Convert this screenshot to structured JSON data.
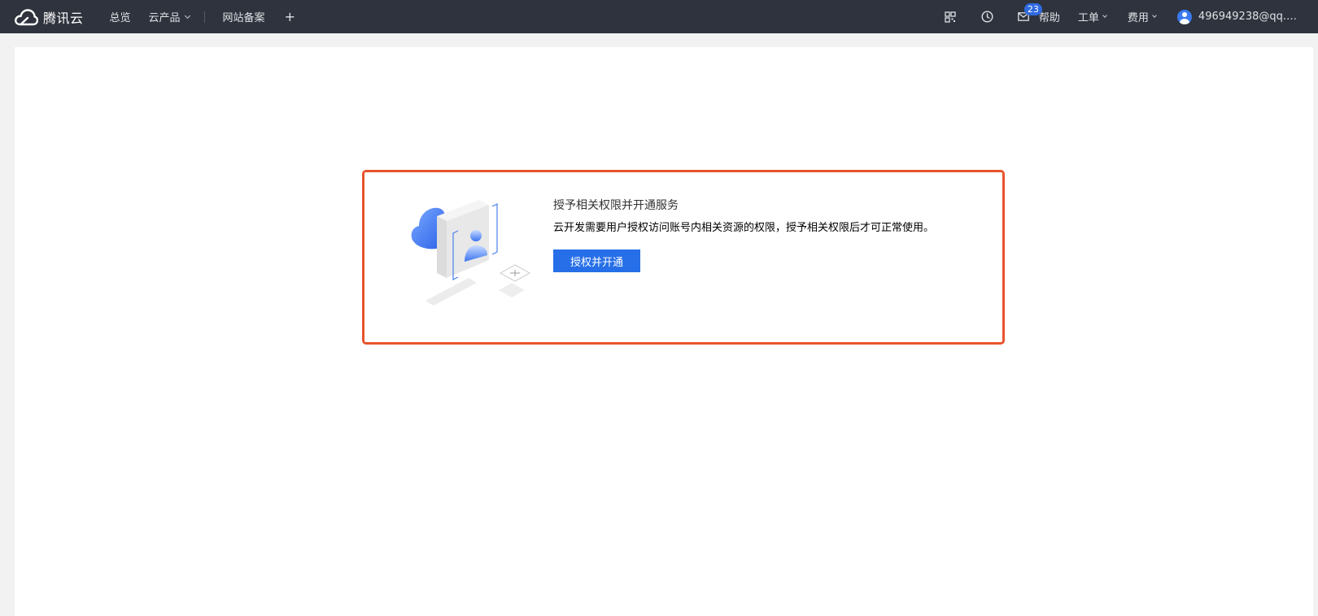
{
  "header": {
    "logo_text": "腾讯云",
    "nav": {
      "overview": "总览",
      "products": "云产品",
      "beian": "网站备案",
      "plus": "+"
    },
    "mail_badge": "23",
    "help": "帮助",
    "ticket": "工单",
    "cost": "费用",
    "user": "496949238@qq.…",
    "icons": {
      "logo": "tencent-cloud-logo-icon",
      "qr": "qrcode-icon",
      "clock": "clock-icon",
      "mail": "mail-icon",
      "avatar": "user-avatar-icon"
    }
  },
  "auth_panel": {
    "title": "授予相关权限并开通服务",
    "description": "云开发需要用户授权访问账号内相关资源的权限，授予相关权限后才可正常使用。",
    "button": "授权并开通"
  },
  "colors": {
    "topbar": "#2e333d",
    "accent": "#266fe8",
    "highlight_border": "#e8532c",
    "badge": "#2f6ae0"
  }
}
